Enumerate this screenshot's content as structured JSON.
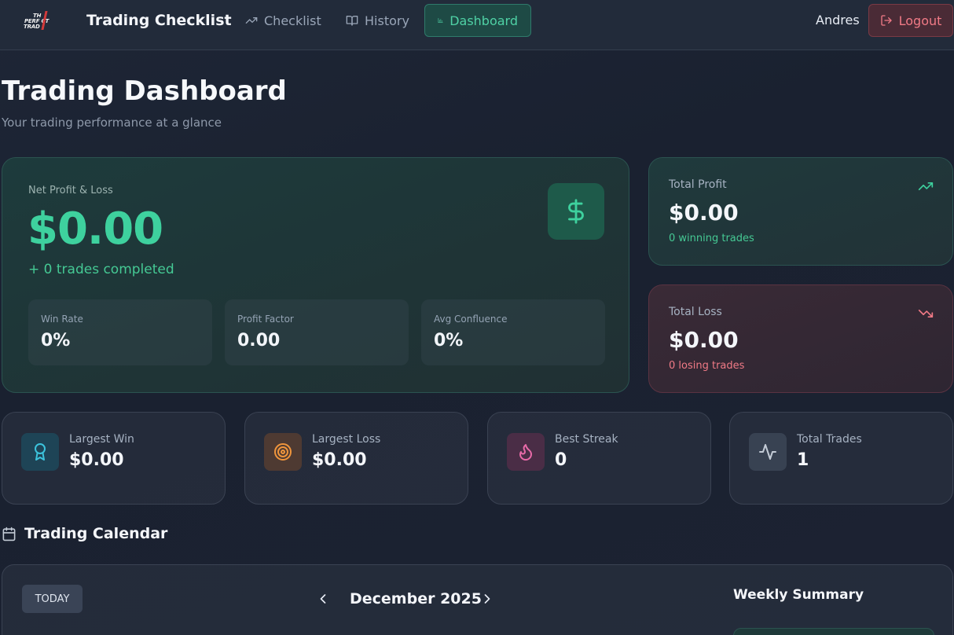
{
  "nav": {
    "logo_lines": [
      "TH",
      "PERF CT",
      "TRAD"
    ],
    "app_title": "Trading Checklist",
    "items": [
      {
        "label": "Checklist",
        "icon": "trending-up-icon"
      },
      {
        "label": "History",
        "icon": "book-open-icon"
      },
      {
        "label": "Dashboard",
        "icon": "bar-chart-icon",
        "active": true
      }
    ],
    "username": "Andres",
    "logout_label": "Logout"
  },
  "header": {
    "title": "Trading Dashboard",
    "subtitle": "Your trading performance at a glance"
  },
  "pnl": {
    "label": "Net Profit & Loss",
    "value": "$0.00",
    "sub": "+ 0 trades completed",
    "icon": "dollar-icon",
    "metrics": [
      {
        "label": "Win Rate",
        "value": "0%"
      },
      {
        "label": "Profit Factor",
        "value": "0.00"
      },
      {
        "label": "Avg Confluence",
        "value": "0%"
      }
    ]
  },
  "total_profit": {
    "label": "Total Profit",
    "value": "$0.00",
    "sub": "0 winning trades",
    "icon": "trending-up-icon"
  },
  "total_loss": {
    "label": "Total Loss",
    "value": "$0.00",
    "sub": "0 losing trades",
    "icon": "trending-down-icon"
  },
  "stats": [
    {
      "label": "Largest Win",
      "value": "$0.00",
      "icon": "award-icon"
    },
    {
      "label": "Largest Loss",
      "value": "$0.00",
      "icon": "target-icon"
    },
    {
      "label": "Best Streak",
      "value": "0",
      "icon": "flame-icon"
    },
    {
      "label": "Total Trades",
      "value": "1",
      "icon": "activity-icon"
    }
  ],
  "calendar": {
    "heading": "Trading Calendar",
    "today_label": "TODAY",
    "month": "December 2025",
    "weekly_summary_title": "Weekly Summary"
  },
  "colors": {
    "accent_green": "#3ed19e",
    "accent_red": "#f07a86",
    "background": "#1c2332"
  }
}
